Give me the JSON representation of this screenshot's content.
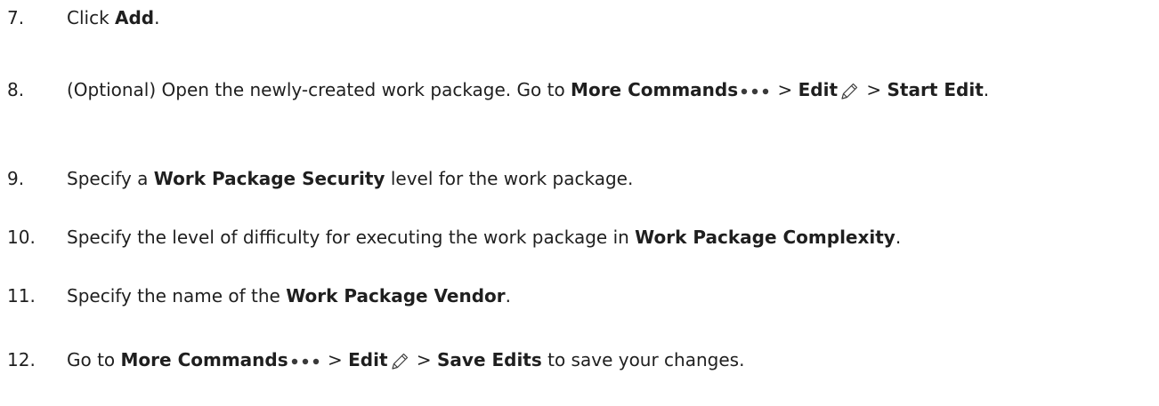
{
  "steps": [
    {
      "num": "7.",
      "parts": [
        {
          "t": "Click "
        },
        {
          "b": "Add"
        },
        {
          "t": "."
        }
      ]
    },
    {
      "num": "8.",
      "parts": [
        {
          "t": "(Optional) Open the newly-created work package. Go to "
        },
        {
          "b": "More Commands"
        },
        {
          "icon": "more-commands-icon"
        },
        {
          "t": " > "
        },
        {
          "b": "Edit"
        },
        {
          "icon": "edit-pencil-icon"
        },
        {
          "t": " > "
        },
        {
          "b": "Start Edit"
        },
        {
          "t": "."
        }
      ]
    },
    {
      "num": "9.",
      "parts": [
        {
          "t": "Specify a "
        },
        {
          "b": "Work Package Security"
        },
        {
          "t": " level for the work package."
        }
      ]
    },
    {
      "num": "10.",
      "parts": [
        {
          "t": "Specify the level of difficulty for executing the work package in "
        },
        {
          "b": "Work Package Complexity"
        },
        {
          "t": "."
        }
      ]
    },
    {
      "num": "11.",
      "parts": [
        {
          "t": "Specify the name of the "
        },
        {
          "b": "Work Package Vendor"
        },
        {
          "t": "."
        }
      ]
    },
    {
      "num": "12.",
      "parts": [
        {
          "t": "Go to "
        },
        {
          "b": "More Commands"
        },
        {
          "icon": "more-commands-icon"
        },
        {
          "t": " > "
        },
        {
          "b": "Edit"
        },
        {
          "icon": "edit-pencil-icon"
        },
        {
          "t": " > "
        },
        {
          "b": "Save Edits"
        },
        {
          "t": " to save your changes."
        }
      ]
    }
  ],
  "colors": {
    "text": "#1f1f1f",
    "background": "#ffffff"
  }
}
